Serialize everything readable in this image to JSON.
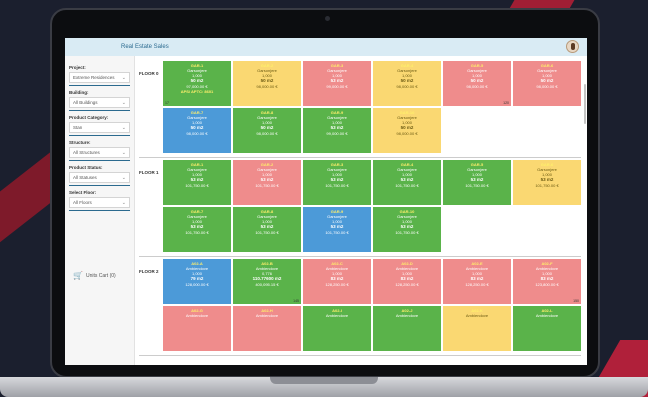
{
  "app": {
    "title": "Real Estate Sales"
  },
  "filters": [
    {
      "label": "Project:",
      "value": "Extreme Residences"
    },
    {
      "label": "Building:",
      "value": "All Buildings"
    },
    {
      "label": "Product Category:",
      "value": "Stan"
    },
    {
      "label": "Structure:",
      "value": "All Structures"
    },
    {
      "label": "Product Status:",
      "value": "All Statuses"
    },
    {
      "label": "Select Floor:",
      "value": "All Floors"
    }
  ],
  "cart": {
    "label": "Units Cart (0)"
  },
  "colors": {
    "available": "#5ab34a",
    "reserved": "#fad872",
    "sold": "#ef8c8c",
    "selected": "#4c9ad8"
  },
  "floors": [
    {
      "label": "FLOOR 0",
      "units": [
        {
          "code": "GAR-1",
          "type": "Garsonjere",
          "count": "1,000",
          "area": "50 m2",
          "price": "97,000.00 €",
          "note": "APS/ APTC: 8601",
          "color": "green",
          "corner_l": "17",
          "corner_r": ""
        },
        {
          "code": "GAR-2",
          "type": "Garsonjere",
          "count": "1,000",
          "area": "50 m2",
          "price": "98,000.00 €",
          "note": "",
          "color": "yellow",
          "corner_l": "",
          "corner_r": ""
        },
        {
          "code": "GAR-3",
          "type": "Garsonjere",
          "count": "1,000",
          "area": "53 m2",
          "price": "99,000.00 €",
          "note": "",
          "color": "red",
          "corner_l": "",
          "corner_r": ""
        },
        {
          "code": "GAR-4",
          "type": "Garsonjere",
          "count": "1,000",
          "area": "50 m2",
          "price": "98,000.00 €",
          "note": "",
          "color": "yellow",
          "corner_l": "",
          "corner_r": ""
        },
        {
          "code": "GAR-5",
          "type": "Garsonjere",
          "count": "1,000",
          "area": "50 m2",
          "price": "98,000.00 €",
          "note": "",
          "color": "red",
          "corner_l": "",
          "corner_r": "120"
        },
        {
          "code": "GAR-6",
          "type": "Garsonjere",
          "count": "1,000",
          "area": "50 m2",
          "price": "98,000.00 €",
          "note": "",
          "color": "red",
          "corner_l": "",
          "corner_r": ""
        },
        {
          "code": "GAR-7",
          "type": "Garsonjere",
          "count": "1,000",
          "area": "50 m2",
          "price": "98,000.00 €",
          "note": "",
          "color": "blue",
          "corner_l": "",
          "corner_r": ""
        },
        {
          "code": "GAR-8",
          "type": "Garsonjere",
          "count": "1,000",
          "area": "50 m2",
          "price": "98,000.00 €",
          "note": "",
          "color": "green",
          "corner_l": "",
          "corner_r": ""
        },
        {
          "code": "GAR-9",
          "type": "Garsonjere",
          "count": "1,000",
          "area": "53 m2",
          "price": "99,000.00 €",
          "note": "",
          "color": "green",
          "corner_l": "",
          "corner_r": ""
        },
        {
          "code": "GAR-10",
          "type": "Garsonjere",
          "count": "1,000",
          "area": "50 m2",
          "price": "98,000.00 €",
          "note": "",
          "color": "yellow",
          "corner_l": "",
          "corner_r": ""
        }
      ]
    },
    {
      "label": "FLOOR 1",
      "units": [
        {
          "code": "GAR-1",
          "type": "Garsonjere",
          "count": "1,000",
          "area": "53 m2",
          "price": "101,750.00 €",
          "note": "",
          "color": "green",
          "corner_l": "",
          "corner_r": ""
        },
        {
          "code": "GAR-2",
          "type": "Garsonjere",
          "count": "1,000",
          "area": "53 m2",
          "price": "101,750.00 €",
          "note": "",
          "color": "red",
          "corner_l": "",
          "corner_r": ""
        },
        {
          "code": "GAR-3",
          "type": "Garsonjere",
          "count": "1,000",
          "area": "53 m2",
          "price": "101,750.00 €",
          "note": "",
          "color": "green",
          "corner_l": "",
          "corner_r": ""
        },
        {
          "code": "GAR-4",
          "type": "Garsonjere",
          "count": "1,000",
          "area": "53 m2",
          "price": "101,750.00 €",
          "note": "",
          "color": "green",
          "corner_l": "",
          "corner_r": ""
        },
        {
          "code": "GAR-5",
          "type": "Garsonjere",
          "count": "1,000",
          "area": "53 m2",
          "price": "101,750.00 €",
          "note": "",
          "color": "green",
          "corner_l": "",
          "corner_r": ""
        },
        {
          "code": "GAR-6",
          "type": "Garsonjere",
          "count": "1,000",
          "area": "53 m2",
          "price": "101,750.00 €",
          "note": "",
          "color": "yellow",
          "corner_l": "",
          "corner_r": ""
        },
        {
          "code": "GAR-7",
          "type": "Garsonjere",
          "count": "1,000",
          "area": "53 m2",
          "price": "101,750.00 €",
          "note": "",
          "color": "green",
          "corner_l": "",
          "corner_r": ""
        },
        {
          "code": "GAR-8",
          "type": "Garsonjere",
          "count": "1,000",
          "area": "53 m2",
          "price": "101,750.00 €",
          "note": "",
          "color": "green",
          "corner_l": "",
          "corner_r": ""
        },
        {
          "code": "GAR-9",
          "type": "Garsonjere",
          "count": "1,000",
          "area": "53 m2",
          "price": "101,750.00 €",
          "note": "",
          "color": "blue",
          "corner_l": "",
          "corner_r": ""
        },
        {
          "code": "GAR-10",
          "type": "Garsonjere",
          "count": "1,000",
          "area": "53 m2",
          "price": "101,750.00 €",
          "note": "",
          "color": "green",
          "corner_l": "",
          "corner_r": ""
        }
      ]
    },
    {
      "label": "FLOOR 2",
      "units": [
        {
          "code": "A02-A",
          "type": "Ambiendove",
          "count": "1,000",
          "area": "79 m2",
          "price": "128,000.00 €",
          "note": "",
          "color": "blue",
          "corner_l": "",
          "corner_r": ""
        },
        {
          "code": "A02-B",
          "type": "Ambiendove",
          "count": "0,776",
          "area": "110.77600 m2",
          "price": "400,095.15 €",
          "note": "",
          "color": "green",
          "corner_l": "",
          "corner_r": "145"
        },
        {
          "code": "A02-C",
          "type": "Ambiendove",
          "count": "1,000",
          "area": "83 m2",
          "price": "128,250.00 €",
          "note": "",
          "color": "red",
          "corner_l": "",
          "corner_r": ""
        },
        {
          "code": "A02-D",
          "type": "Ambiendove",
          "count": "1,000",
          "area": "83 m2",
          "price": "128,250.00 €",
          "note": "",
          "color": "red",
          "corner_l": "",
          "corner_r": ""
        },
        {
          "code": "A02-E",
          "type": "Ambiendove",
          "count": "1,000",
          "area": "83 m2",
          "price": "128,250.00 €",
          "note": "",
          "color": "red",
          "corner_l": "",
          "corner_r": ""
        },
        {
          "code": "A02-F",
          "type": "Ambiendove",
          "count": "1,000",
          "area": "83 m2",
          "price": "123,800.00 €",
          "note": "",
          "color": "red",
          "corner_l": "",
          "corner_r": "150"
        },
        {
          "code": "A02-G",
          "type": "Ambiendove",
          "count": "",
          "area": "",
          "price": "",
          "note": "",
          "color": "red",
          "corner_l": "",
          "corner_r": ""
        },
        {
          "code": "A02-H",
          "type": "Ambiendove",
          "count": "",
          "area": "",
          "price": "",
          "note": "",
          "color": "red",
          "corner_l": "",
          "corner_r": ""
        },
        {
          "code": "A02-I",
          "type": "Ambiendove",
          "count": "",
          "area": "",
          "price": "",
          "note": "",
          "color": "green",
          "corner_l": "",
          "corner_r": ""
        },
        {
          "code": "A02-J",
          "type": "Ambiendove",
          "count": "",
          "area": "",
          "price": "",
          "note": "",
          "color": "green",
          "corner_l": "",
          "corner_r": ""
        },
        {
          "code": "A02-K",
          "type": "Ambiendove",
          "count": "",
          "area": "",
          "price": "",
          "note": "",
          "color": "yellow",
          "corner_l": "",
          "corner_r": ""
        },
        {
          "code": "A02-L",
          "type": "Ambiendove",
          "count": "",
          "area": "",
          "price": "",
          "note": "",
          "color": "green",
          "corner_l": "",
          "corner_r": ""
        }
      ]
    }
  ]
}
